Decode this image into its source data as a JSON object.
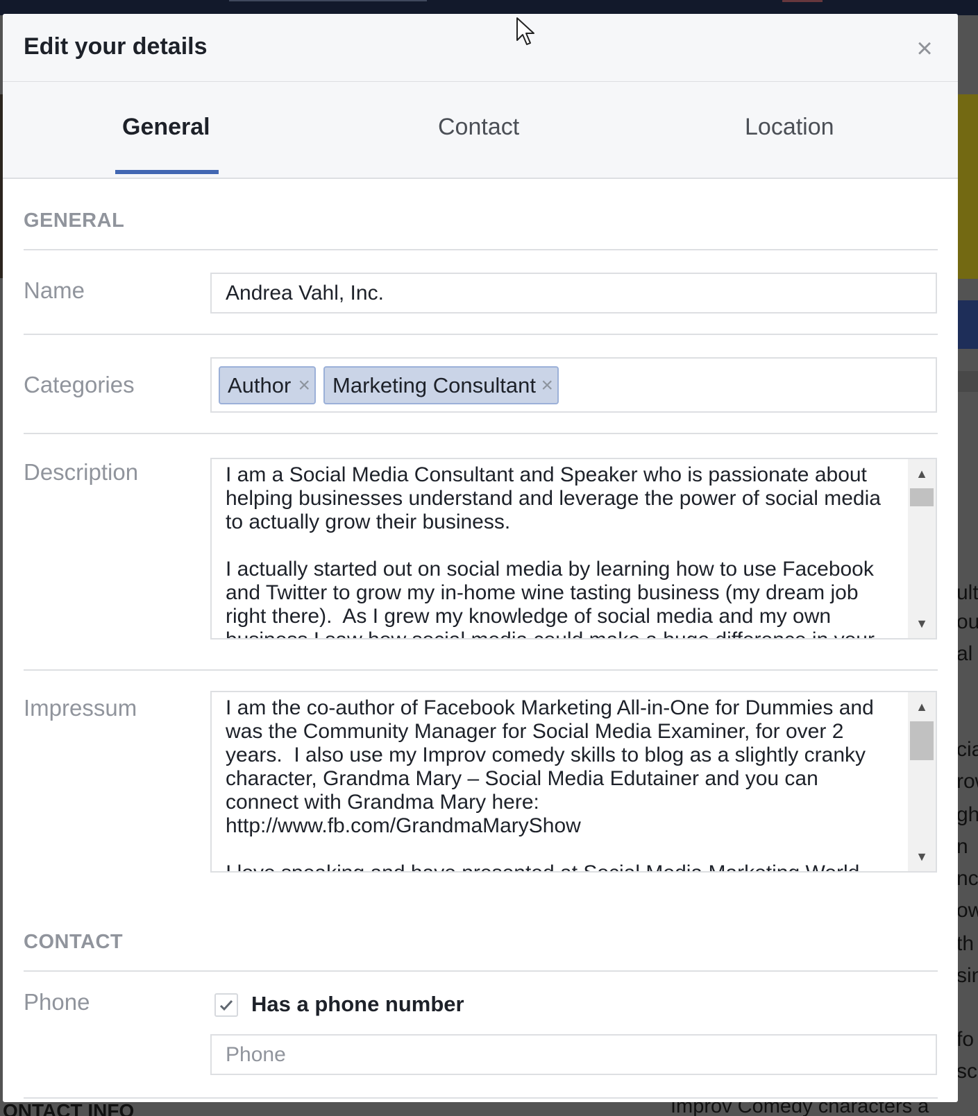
{
  "background": {
    "right_fragments": [
      "ulta",
      "ous",
      "al",
      "cia",
      "row",
      "ght",
      "n",
      "nce",
      "ow",
      "th",
      "sin",
      "fo",
      "sc"
    ],
    "bottom_left_text": "ONTACT INFO",
    "bottom_right_text": "Improv Comedy characters a"
  },
  "modal": {
    "title": "Edit your details",
    "close_label": "×"
  },
  "tabs": [
    {
      "label": "General",
      "active": true
    },
    {
      "label": "Contact",
      "active": false
    },
    {
      "label": "Location",
      "active": false
    }
  ],
  "general": {
    "heading": "GENERAL",
    "name_label": "Name",
    "name_value": "Andrea Vahl, Inc.",
    "categories_label": "Categories",
    "categories": [
      "Author",
      "Marketing Consultant"
    ],
    "category_remove": "×",
    "description_label": "Description",
    "description_value": "I am a Social Media Consultant and Speaker who is passionate about helping businesses understand and leverage the power of social media to actually grow their business.\n\nI actually started out on social media by learning how to use Facebook and Twitter to grow my in-home wine tasting business (my dream job right there).  As I grew my knowledge of social media and my own business I saw how social media could make a huge difference in your",
    "impressum_label": "Impressum",
    "impressum_value": "I am the co-author of Facebook Marketing All-in-One for Dummies and was the Community Manager for Social Media Examiner, for over 2 years.  I also use my Improv comedy skills to blog as a slightly cranky character, Grandma Mary – Social Media Edutainer and you can connect with Grandma Mary here: http://www.fb.com/GrandmaMaryShow\n\nI love speaking and have presented at Social Media Marketing World"
  },
  "contact": {
    "heading": "CONTACT",
    "phone_label": "Phone",
    "has_phone_label": "Has a phone number",
    "has_phone_checked": true,
    "phone_placeholder": "Phone"
  },
  "scrollbar_arrows": {
    "up": "▲",
    "down": "▼"
  },
  "colors": {
    "accent": "#4267b2",
    "token_bg": "#cad4e7",
    "label_gray": "#90949c"
  }
}
